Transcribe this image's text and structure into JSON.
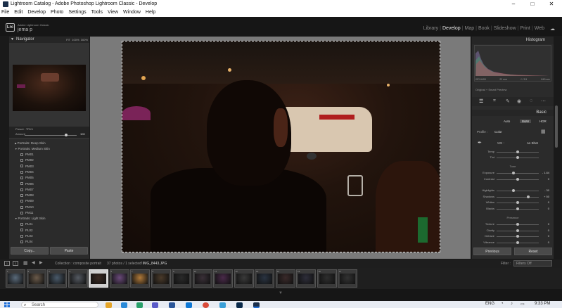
{
  "window": {
    "title": "Lightroom Catalog - Adobe Photoshop Lightroom Classic - Develop",
    "controls": {
      "minimize": "–",
      "maximize": "□",
      "close": "✕"
    }
  },
  "menu": [
    "File",
    "Edit",
    "Develop",
    "Photo",
    "Settings",
    "Tools",
    "View",
    "Window",
    "Help"
  ],
  "identity": {
    "logo": "Lrc",
    "app_small": "Adobe Lightroom Classic",
    "user": "jema p"
  },
  "modules": [
    "Library",
    "Develop",
    "Map",
    "Book",
    "Slideshow",
    "Print",
    "Web"
  ],
  "active_module": "Develop",
  "left_panel": {
    "navigator_label": "Navigator",
    "zoom_options": [
      "FIT",
      "100%",
      "300%"
    ],
    "preset_label": "Preset : TRX1",
    "amount_label": "Amount",
    "amount_value": "100",
    "amount_fraction": 0.8,
    "groups": [
      {
        "label": "Portraits: Deep Skin",
        "expanded": false,
        "items": []
      },
      {
        "label": "Portraits: Medium Skin",
        "expanded": true,
        "items": [
          "PM01",
          "PM02",
          "PM03",
          "PM04",
          "PM05",
          "PM06",
          "PM07",
          "PM08",
          "PM09",
          "PM10",
          "PM11"
        ]
      },
      {
        "label": "Portraits: Light Skin",
        "expanded": true,
        "items": [
          "PL01",
          "PL02",
          "PL03",
          "PL04"
        ]
      }
    ],
    "copy_label": "Copy...",
    "paste_label": "Paste"
  },
  "right_panel": {
    "histogram_label": "Histogram",
    "exif": [
      "ISO 6400",
      "22 mm",
      "f / 3.5",
      "1/60 sec"
    ],
    "preview_label": "Original + Smart Preview",
    "basic_label": "Basic",
    "treatment": [
      "Auto",
      "B&W",
      "HDR"
    ],
    "profile_label": "Profile :",
    "profile_value": "Color",
    "wb_label": "WB :",
    "wb_value": "As Shot",
    "wb_sliders": [
      {
        "label": "Temp",
        "value": "",
        "position": 0.5
      },
      {
        "label": "Tint",
        "value": "",
        "position": 0.5
      }
    ],
    "tone_label": "Tone",
    "tone_sliders": [
      {
        "label": "Exposure",
        "value": "- 1.84",
        "position": 0.4
      },
      {
        "label": "Contrast",
        "value": "0",
        "position": 0.5
      },
      {
        "label": "Highlights",
        "value": "- 30",
        "position": 0.4
      },
      {
        "label": "Shadows",
        "value": "+ 50",
        "position": 0.75
      },
      {
        "label": "Whites",
        "value": "0",
        "position": 0.5
      },
      {
        "label": "Blacks",
        "value": "0",
        "position": 0.5
      }
    ],
    "presence_label": "Presence",
    "presence_sliders": [
      {
        "label": "Texture",
        "value": "0",
        "position": 0.5
      },
      {
        "label": "Clarity",
        "value": "0",
        "position": 0.5
      },
      {
        "label": "Dehaze",
        "value": "0",
        "position": 0.5
      },
      {
        "label": "Vibrance",
        "value": "0",
        "position": 0.5
      }
    ],
    "previous_label": "Previous",
    "reset_label": "Reset"
  },
  "filmstrip": {
    "pages": [
      "1",
      "2"
    ],
    "path": "Collection : composite portrait",
    "count": "37 photos / 1 selected",
    "file": "/ IMG_8443.JPG",
    "filter_label": "Filter :",
    "filter_value": "Filters Off",
    "selected_index": 4,
    "thumbs": [
      {
        "n": "1",
        "c": "#5a6a7a"
      },
      {
        "n": "2",
        "c": "#6a5a4a"
      },
      {
        "n": "3",
        "c": "#4a5a6a"
      },
      {
        "n": "4",
        "c": "#555a62"
      },
      {
        "n": "5",
        "c": "#3a2a22"
      },
      {
        "n": "6",
        "c": "#6a4a7a"
      },
      {
        "n": "7",
        "c": "#b07a3a"
      },
      {
        "n": "8",
        "c": "#4a3a2a"
      },
      {
        "n": "9",
        "c": "#2a2a2a"
      },
      {
        "n": "10",
        "c": "#3a3038"
      },
      {
        "n": "11",
        "c": "#4a2a4a"
      },
      {
        "n": "12",
        "c": "#3a3a3a"
      },
      {
        "n": "13",
        "c": "#2a3442"
      },
      {
        "n": "14",
        "c": "#3a2a2a"
      },
      {
        "n": "15",
        "c": "#2e2e3a"
      },
      {
        "n": "16",
        "c": "#2e2e2e"
      },
      {
        "n": "17",
        "c": "#333"
      }
    ]
  },
  "taskbar": {
    "search_placeholder": "Search",
    "language": "ENG",
    "time": "9:33 PM"
  }
}
